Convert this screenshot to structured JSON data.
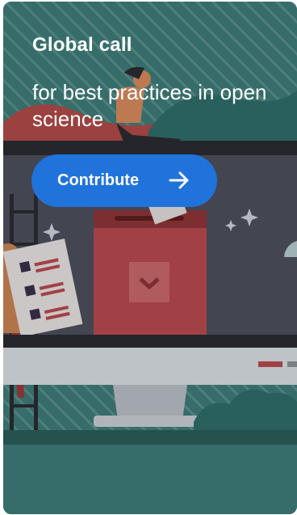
{
  "card": {
    "title": "Global call",
    "subtitle": "for best practices in open science",
    "cta_label": "Contribute",
    "cta_icon": "arrow-right-icon"
  },
  "colors": {
    "background_teal": "#3e7d79",
    "button_blue": "#1f73db",
    "ballot_box_red": "#b94a4f",
    "text": "#ffffff"
  }
}
